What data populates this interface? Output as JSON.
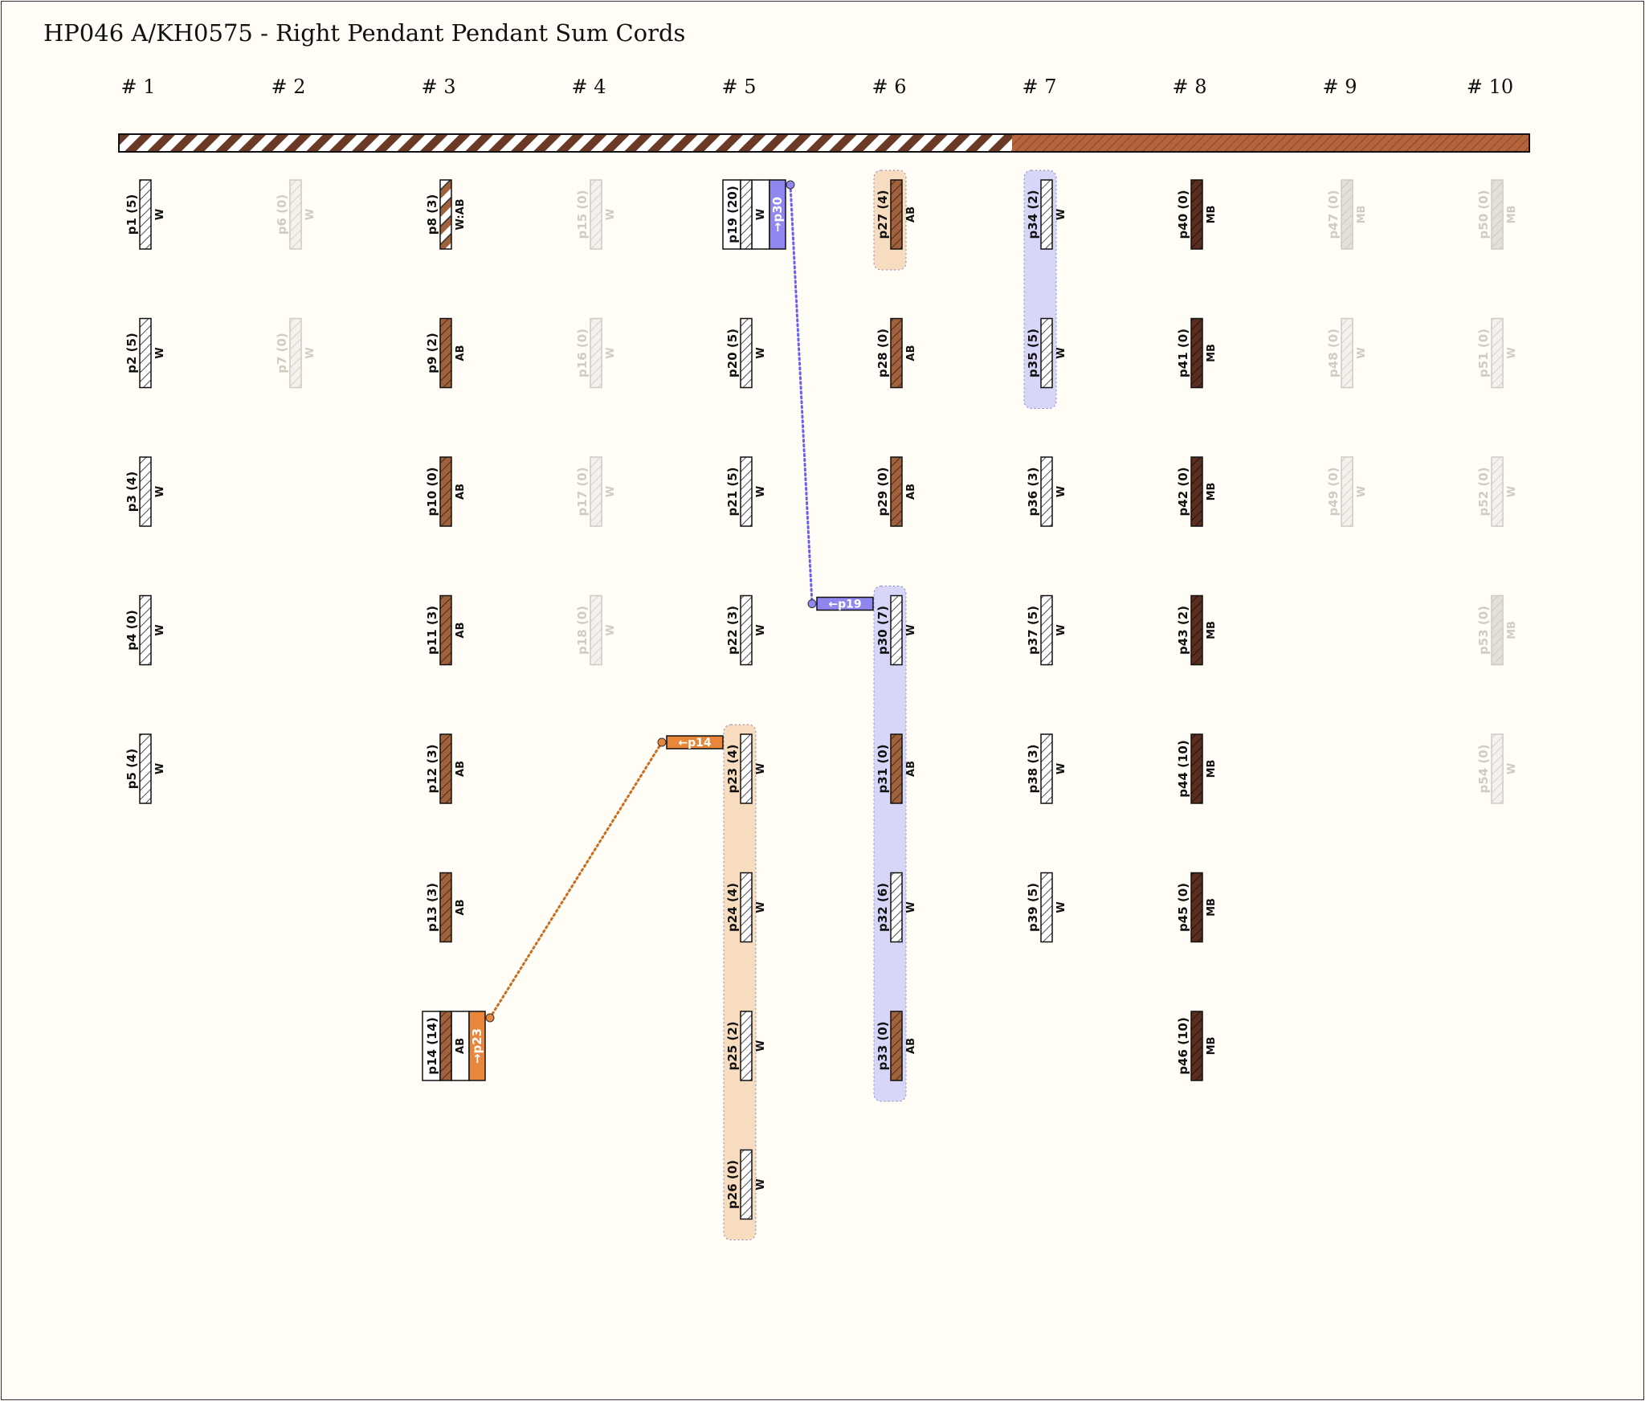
{
  "title": "HP046 A/KH0575 - Right Pendant Pendant Sum Cords",
  "group_labels": [
    "# 1",
    "# 2",
    "# 3",
    "# 4",
    "# 5",
    "# 6",
    "# 7",
    "# 8",
    "# 9",
    "# 10"
  ],
  "colors": {
    "white_cord": "#ffffff",
    "AB": "#a0623c",
    "MB": "#5a2e1e",
    "ghost": "#d9d6d0",
    "orange_link": "#e8873a",
    "orange_bg": "#f8dcc0",
    "blue_link": "#8f86f0",
    "blue_bg": "#d8d6f8",
    "primary_cord_dark": "#6b3a26",
    "primary_cord_light": "#ffffff",
    "primary_cord_right": "#b5653e"
  },
  "cords": [
    {
      "id": "p1",
      "label": "p1 (5)",
      "color": "W",
      "group": 1,
      "row": 0
    },
    {
      "id": "p2",
      "label": "p2 (5)",
      "color": "W",
      "group": 1,
      "row": 1
    },
    {
      "id": "p3",
      "label": "p3 (4)",
      "color": "W",
      "group": 1,
      "row": 2
    },
    {
      "id": "p4",
      "label": "p4 (0)",
      "color": "W",
      "group": 1,
      "row": 3
    },
    {
      "id": "p5",
      "label": "p5 (4)",
      "color": "W",
      "group": 1,
      "row": 4
    },
    {
      "id": "p6",
      "label": "p6 (0)",
      "color": "W",
      "group": 2,
      "row": 0,
      "ghost": true
    },
    {
      "id": "p7",
      "label": "p7 (0)",
      "color": "W",
      "group": 2,
      "row": 1,
      "ghost": true
    },
    {
      "id": "p8",
      "label": "p8 (3)",
      "color": "W:AB",
      "group": 3,
      "row": 0
    },
    {
      "id": "p9",
      "label": "p9 (2)",
      "color": "AB",
      "group": 3,
      "row": 1
    },
    {
      "id": "p10",
      "label": "p10 (0)",
      "color": "AB",
      "group": 3,
      "row": 2
    },
    {
      "id": "p11",
      "label": "p11 (3)",
      "color": "AB",
      "group": 3,
      "row": 3
    },
    {
      "id": "p12",
      "label": "p12 (3)",
      "color": "AB",
      "group": 3,
      "row": 4
    },
    {
      "id": "p13",
      "label": "p13 (3)",
      "color": "AB",
      "group": 3,
      "row": 5
    },
    {
      "id": "p14",
      "label": "p14 (14)",
      "color": "AB",
      "group": 3,
      "row": 6,
      "sum_of": "→p23"
    },
    {
      "id": "p15",
      "label": "p15 (0)",
      "color": "W",
      "group": 4,
      "row": 0,
      "ghost": true
    },
    {
      "id": "p16",
      "label": "p16 (0)",
      "color": "W",
      "group": 4,
      "row": 1,
      "ghost": true
    },
    {
      "id": "p17",
      "label": "p17 (0)",
      "color": "W",
      "group": 4,
      "row": 2,
      "ghost": true
    },
    {
      "id": "p18",
      "label": "p18 (0)",
      "color": "W",
      "group": 4,
      "row": 3,
      "ghost": true
    },
    {
      "id": "p19",
      "label": "p19 (20)",
      "color": "W",
      "group": 5,
      "row": 0,
      "sum_of": "→p30"
    },
    {
      "id": "p20",
      "label": "p20 (5)",
      "color": "W",
      "group": 5,
      "row": 1
    },
    {
      "id": "p21",
      "label": "p21 (5)",
      "color": "W",
      "group": 5,
      "row": 2
    },
    {
      "id": "p22",
      "label": "p22 (3)",
      "color": "W",
      "group": 5,
      "row": 3
    },
    {
      "id": "p23",
      "label": "p23 (4)",
      "color": "W",
      "group": 5,
      "row": 4
    },
    {
      "id": "p24",
      "label": "p24 (4)",
      "color": "W",
      "group": 5,
      "row": 5
    },
    {
      "id": "p25",
      "label": "p25 (2)",
      "color": "W",
      "group": 5,
      "row": 6
    },
    {
      "id": "p26",
      "label": "p26 (0)",
      "color": "W",
      "group": 5,
      "row": 7
    },
    {
      "id": "p27",
      "label": "p27 (4)",
      "color": "AB",
      "group": 6,
      "row": 0
    },
    {
      "id": "p28",
      "label": "p28 (0)",
      "color": "AB",
      "group": 6,
      "row": 1
    },
    {
      "id": "p29",
      "label": "p29 (0)",
      "color": "AB",
      "group": 6,
      "row": 2
    },
    {
      "id": "p30",
      "label": "p30 (7)",
      "color": "W",
      "group": 6,
      "row": 3
    },
    {
      "id": "p31",
      "label": "p31 (0)",
      "color": "AB",
      "group": 6,
      "row": 4
    },
    {
      "id": "p32",
      "label": "p32 (6)",
      "color": "W",
      "group": 6,
      "row": 5
    },
    {
      "id": "p33",
      "label": "p33 (0)",
      "color": "AB",
      "group": 6,
      "row": 6
    },
    {
      "id": "p34",
      "label": "p34 (2)",
      "color": "W",
      "group": 7,
      "row": 0
    },
    {
      "id": "p35",
      "label": "p35 (5)",
      "color": "W",
      "group": 7,
      "row": 1
    },
    {
      "id": "p36",
      "label": "p36 (3)",
      "color": "W",
      "group": 7,
      "row": 2
    },
    {
      "id": "p37",
      "label": "p37 (5)",
      "color": "W",
      "group": 7,
      "row": 3
    },
    {
      "id": "p38",
      "label": "p38 (3)",
      "color": "W",
      "group": 7,
      "row": 4
    },
    {
      "id": "p39",
      "label": "p39 (5)",
      "color": "W",
      "group": 7,
      "row": 5
    },
    {
      "id": "p40",
      "label": "p40 (0)",
      "color": "MB",
      "group": 8,
      "row": 0
    },
    {
      "id": "p41",
      "label": "p41 (0)",
      "color": "MB",
      "group": 8,
      "row": 1
    },
    {
      "id": "p42",
      "label": "p42 (0)",
      "color": "MB",
      "group": 8,
      "row": 2
    },
    {
      "id": "p43",
      "label": "p43 (2)",
      "color": "MB",
      "group": 8,
      "row": 3
    },
    {
      "id": "p44",
      "label": "p44 (10)",
      "color": "MB",
      "group": 8,
      "row": 4
    },
    {
      "id": "p45",
      "label": "p45 (0)",
      "color": "MB",
      "group": 8,
      "row": 5
    },
    {
      "id": "p46",
      "label": "p46 (10)",
      "color": "MB",
      "group": 8,
      "row": 6
    },
    {
      "id": "p47",
      "label": "p47 (0)",
      "color": "MB",
      "group": 9,
      "row": 0,
      "ghost": true
    },
    {
      "id": "p48",
      "label": "p48 (0)",
      "color": "W",
      "group": 9,
      "row": 1,
      "ghost": true
    },
    {
      "id": "p49",
      "label": "p49 (0)",
      "color": "W",
      "group": 9,
      "row": 2,
      "ghost": true
    },
    {
      "id": "p50",
      "label": "p50 (0)",
      "color": "MB",
      "group": 10,
      "row": 0,
      "ghost": true
    },
    {
      "id": "p51",
      "label": "p51 (0)",
      "color": "W",
      "group": 10,
      "row": 1,
      "ghost": true
    },
    {
      "id": "p52",
      "label": "p52 (0)",
      "color": "W",
      "group": 10,
      "row": 2,
      "ghost": true
    },
    {
      "id": "p53",
      "label": "p53 (0)",
      "color": "MB",
      "group": 10,
      "row": 3,
      "ghost": true
    },
    {
      "id": "p54",
      "label": "p54 (0)",
      "color": "W",
      "group": 10,
      "row": 4,
      "ghost": true
    }
  ],
  "sum_links": [
    {
      "from": "p14",
      "to": "p23",
      "tag": "←p14",
      "color": "orange",
      "summands": [
        "p23",
        "p24",
        "p25",
        "p26"
      ]
    },
    {
      "from": "p19",
      "to": "p30",
      "tag": "←p19",
      "color": "blue",
      "summands": [
        "p30",
        "p31",
        "p32",
        "p33"
      ]
    }
  ],
  "highlight_groups": [
    {
      "color": "orange",
      "cords": [
        "p27"
      ]
    },
    {
      "color": "blue",
      "cords": [
        "p34",
        "p35"
      ]
    }
  ]
}
